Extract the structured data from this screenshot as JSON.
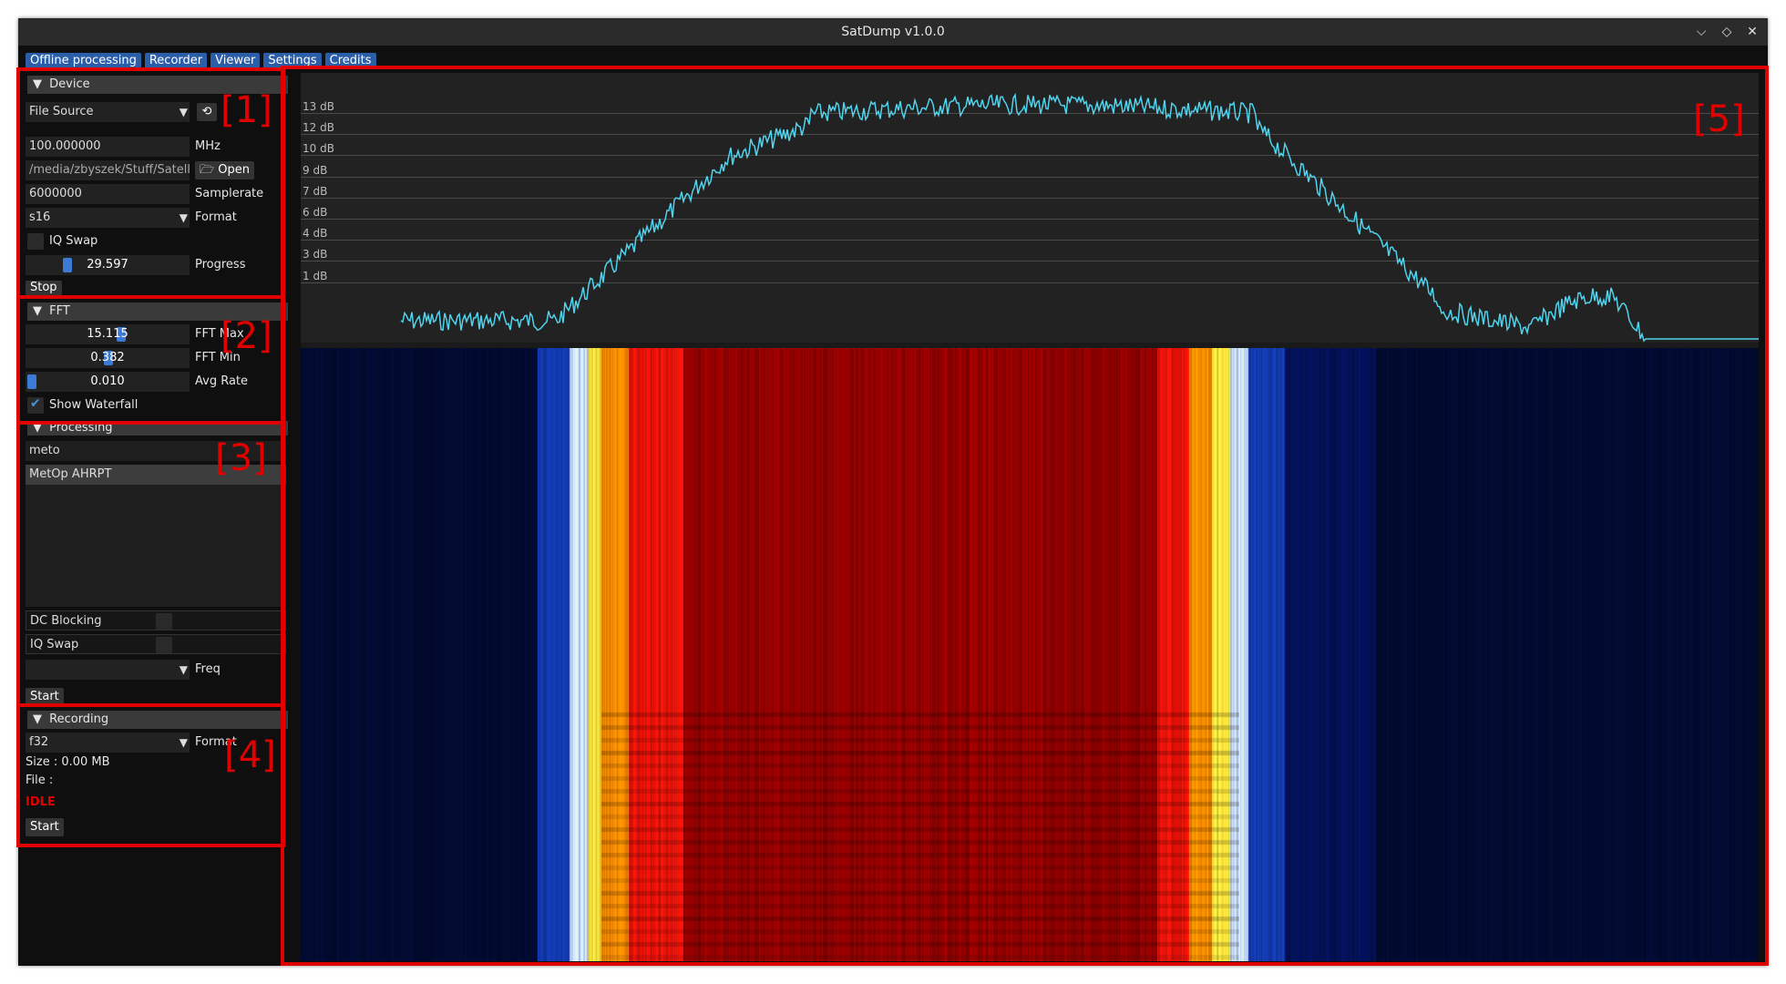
{
  "window": {
    "title": "SatDump v1.0.0"
  },
  "controls": {
    "minimize": "⌵",
    "restore": "◇",
    "close": "✕"
  },
  "tabs": [
    "Offline processing",
    "Recorder",
    "Viewer",
    "Settings",
    "Credits"
  ],
  "device": {
    "header": "Device",
    "source": "File Source",
    "frequency": "100.000000",
    "freq_unit": "MHz",
    "path": "/media/zbyszek/Stuff/Satelli",
    "open_label": "Open",
    "samplerate": "6000000",
    "samplerate_label": "Samplerate",
    "format": "s16",
    "format_label": "Format",
    "iq_swap_label": "IQ Swap",
    "progress": "29.597",
    "progress_label": "Progress",
    "progress_fraction": 0.24,
    "stop_label": "Stop"
  },
  "fft": {
    "header": "FFT",
    "max_value": "15.115",
    "max_label": "FFT Max",
    "min_value": "0.382",
    "min_label": "FFT Min",
    "avg_value": "0.010",
    "avg_label": "Avg Rate",
    "waterfall_label": "Show Waterfall"
  },
  "processing": {
    "header": "Processing",
    "search": "meto",
    "items": [
      "MetOp AHRPT"
    ],
    "dc_blocking_label": "DC Blocking",
    "iq_swap_label": "IQ Swap",
    "freq_label": "Freq",
    "start_label": "Start"
  },
  "recording": {
    "header": "Recording",
    "format": "f32",
    "format_label": "Format",
    "size": "Size : 0.00 MB",
    "file": "File :",
    "status": "IDLE",
    "start_label": "Start"
  },
  "annotations": [
    "[1]",
    "[2]",
    "[3]",
    "[4]",
    "[5]"
  ],
  "plot": {
    "db_labels": [
      "13 dB",
      "12 dB",
      "10 dB",
      "9 dB",
      "7 dB",
      "6 dB",
      "4 dB",
      "3 dB",
      "1 dB"
    ],
    "trace_color": "#4fd3ec",
    "accent": "#3c7ad6"
  }
}
